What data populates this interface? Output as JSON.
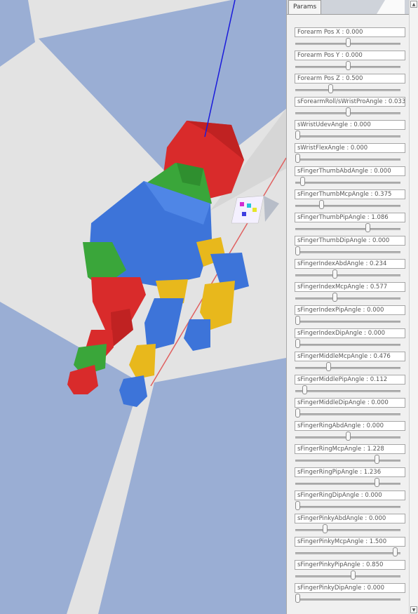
{
  "tab_label": "Params",
  "params": [
    {
      "label": "Forearm Pos X : 0.000",
      "value": 0.5
    },
    {
      "label": "Forearm Pos Y : 0.000",
      "value": 0.5
    },
    {
      "label": "Forearm Pos Z : 0.500",
      "value": 0.33
    },
    {
      "label": "sForearmRoll/sWristProAngle : 0.033",
      "value": 0.5
    },
    {
      "label": "sWristUdevAngle : 0.000",
      "value": 0.0
    },
    {
      "label": "sWristFlexAngle : 0.000",
      "value": 0.0
    },
    {
      "label": "sFingerThumbAbdAngle : 0.000",
      "value": 0.05
    },
    {
      "label": "sFingerThumbMcpAngle : 0.375",
      "value": 0.24
    },
    {
      "label": "sFingerThumbPipAngle : 1.086",
      "value": 0.7
    },
    {
      "label": "sFingerThumbDipAngle : 0.000",
      "value": 0.0
    },
    {
      "label": "sFingerIndexAbdAngle : 0.234",
      "value": 0.37
    },
    {
      "label": "sFingerIndexMcpAngle : 0.577",
      "value": 0.37
    },
    {
      "label": "sFingerIndexPipAngle : 0.000",
      "value": 0.0
    },
    {
      "label": "sFingerIndexDipAngle : 0.000",
      "value": 0.0
    },
    {
      "label": "sFingerMiddleMcpAngle : 0.476",
      "value": 0.31
    },
    {
      "label": "sFingerMiddlePipAngle : 0.112",
      "value": 0.07
    },
    {
      "label": "sFingerMiddleDipAngle : 0.000",
      "value": 0.0
    },
    {
      "label": "sFingerRingAbdAngle : 0.000",
      "value": 0.5
    },
    {
      "label": "sFingerRingMcpAngle : 1.228",
      "value": 0.79
    },
    {
      "label": "sFingerRingPipAngle : 1.236",
      "value": 0.79
    },
    {
      "label": "sFingerRingDipAngle : 0.000",
      "value": 0.0
    },
    {
      "label": "sFingerPinkyAbdAngle : 0.000",
      "value": 0.27
    },
    {
      "label": "sFingerPinkyMcpAngle : 1.500",
      "value": 0.97
    },
    {
      "label": "sFingerPinkyPipAngle : 0.850",
      "value": 0.55
    },
    {
      "label": "sFingerPinkyDipAngle : 0.000",
      "value": 0.0
    }
  ],
  "colors": {
    "floor_blue": "#9aaed4",
    "floor_light": "#e3e3e3",
    "hand_red": "#d92b2b",
    "hand_green": "#3aa63a",
    "hand_blue": "#3d74d9",
    "hand_yellow": "#e8b81c",
    "axis_blue": "#1a1adb",
    "axis_red": "#e06060"
  },
  "icons": {
    "scroll_up": "scroll-up-arrow-icon",
    "scroll_down": "scroll-down-arrow-icon"
  }
}
